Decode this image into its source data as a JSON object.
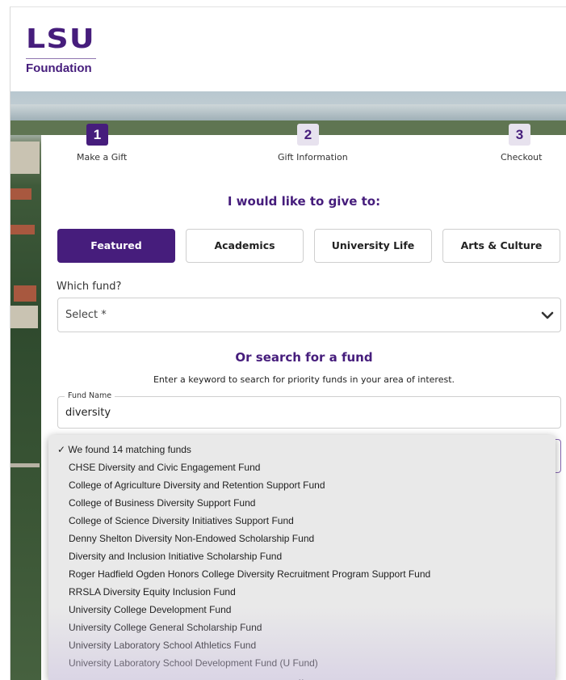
{
  "header": {
    "logo_mark": "LSU",
    "logo_sub": "Foundation"
  },
  "steps": [
    {
      "number": "1",
      "label": "Make a Gift",
      "active": true
    },
    {
      "number": "2",
      "label": "Gift Information",
      "active": false
    },
    {
      "number": "3",
      "label": "Checkout",
      "active": false
    }
  ],
  "give_heading": "I would like to give to:",
  "tabs": [
    {
      "label": "Featured",
      "active": true
    },
    {
      "label": "Academics",
      "active": false
    },
    {
      "label": "University Life",
      "active": false
    },
    {
      "label": "Arts & Culture",
      "active": false
    }
  ],
  "fund_select": {
    "label": "Which fund?",
    "placeholder": "Select *",
    "icon": "chevron-down-icon"
  },
  "search": {
    "heading": "Or search for a fund",
    "instruction": "Enter a keyword to search for priority funds in your area of interest.",
    "field_label": "Fund Name",
    "value": "diversity"
  },
  "results": {
    "summary": "✓ We found 14 matching funds",
    "options": [
      "CHSE Diversity and Civic Engagement Fund",
      "College of Agriculture Diversity and Retention Support Fund",
      "College of Business Diversity Support Fund",
      "College of Science Diversity Initiatives Support Fund",
      "Denny Shelton Diversity Non-Endowed Scholarship Fund",
      "Diversity and Inclusion Initiative Scholarship Fund",
      "Roger Hadfield Ogden Honors College Diversity Recruitment Program Support Fund",
      "RRSLA Diversity Equity Inclusion Fund",
      "University College Development Fund",
      "University College General Scholarship Fund",
      "University Laboratory School Athletics Fund",
      "University Laboratory School Development Fund (U Fund)"
    ],
    "more_indicator": "⌄"
  },
  "colors": {
    "brand_purple": "#461d7c",
    "step_inactive_bg": "#e7e2ee",
    "dropdown_bg": "#e9e9e9"
  }
}
